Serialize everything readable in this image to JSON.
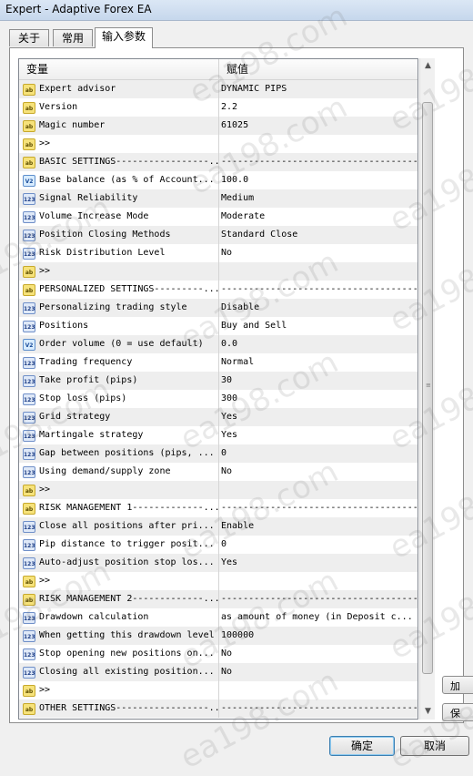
{
  "window": {
    "title": "Expert - Adaptive Forex EA"
  },
  "tabs": [
    {
      "label": "关于"
    },
    {
      "label": "常用"
    },
    {
      "label": "输入参数"
    }
  ],
  "grid": {
    "header": {
      "variable": "变量",
      "value": "赋值"
    },
    "rows": [
      {
        "icon": "ab",
        "name": "Expert advisor",
        "value": "DYNAMIC PIPS"
      },
      {
        "icon": "ab",
        "name": "Version",
        "value": "2.2"
      },
      {
        "icon": "ab",
        "name": "Magic number",
        "value": "61025"
      },
      {
        "icon": "ab",
        "name": ">>",
        "value": ""
      },
      {
        "icon": "ab",
        "name": "BASIC SETTINGS-----------------...",
        "value": "------------------------------------..."
      },
      {
        "icon": "v2",
        "name": "Base balance (as % of Account...",
        "value": "100.0"
      },
      {
        "icon": "123",
        "name": "Signal Reliability",
        "value": "Medium"
      },
      {
        "icon": "123",
        "name": "Volume Increase Mode",
        "value": "Moderate"
      },
      {
        "icon": "123",
        "name": "Position Closing Methods",
        "value": "Standard Close"
      },
      {
        "icon": "123",
        "name": "Risk Distribution Level",
        "value": "No"
      },
      {
        "icon": "ab",
        "name": ">>",
        "value": ""
      },
      {
        "icon": "ab",
        "name": "PERSONALIZED SETTINGS---------...",
        "value": "------------------------------------..."
      },
      {
        "icon": "123",
        "name": "Personalizing trading style",
        "value": "Disable"
      },
      {
        "icon": "123",
        "name": "Positions",
        "value": "Buy and Sell"
      },
      {
        "icon": "v2",
        "name": "Order volume (0 = use default)",
        "value": "0.0"
      },
      {
        "icon": "123",
        "name": "Trading frequency",
        "value": "Normal"
      },
      {
        "icon": "123",
        "name": "Take profit (pips)",
        "value": "30"
      },
      {
        "icon": "123",
        "name": "Stop loss (pips)",
        "value": "300"
      },
      {
        "icon": "123",
        "name": "Grid strategy",
        "value": "Yes"
      },
      {
        "icon": "123",
        "name": "Martingale strategy",
        "value": "Yes"
      },
      {
        "icon": "123",
        "name": "Gap between positions (pips, ...",
        "value": "0"
      },
      {
        "icon": "123",
        "name": "Using demand/supply zone",
        "value": "No"
      },
      {
        "icon": "ab",
        "name": ">>",
        "value": ""
      },
      {
        "icon": "ab",
        "name": "RISK MANAGEMENT 1-------------...",
        "value": "------------------------------------..."
      },
      {
        "icon": "123",
        "name": "Close all positions after pri...",
        "value": "Enable"
      },
      {
        "icon": "123",
        "name": "Pip distance to trigger posit...",
        "value": "0"
      },
      {
        "icon": "123",
        "name": "Auto-adjust position stop los...",
        "value": "Yes"
      },
      {
        "icon": "ab",
        "name": ">>",
        "value": ""
      },
      {
        "icon": "ab",
        "name": "RISK MANAGEMENT 2-------------...",
        "value": "------------------------------------..."
      },
      {
        "icon": "123",
        "name": "Drawdown calculation",
        "value": "as amount of money (in Deposit c..."
      },
      {
        "icon": "123",
        "name": "When getting this drawdown level",
        "value": "100000"
      },
      {
        "icon": "123",
        "name": "Stop opening new positions on...",
        "value": "No"
      },
      {
        "icon": "123",
        "name": "Closing all existing position...",
        "value": "No"
      },
      {
        "icon": "ab",
        "name": ">>",
        "value": ""
      },
      {
        "icon": "ab",
        "name": "OTHER SETTINGS-----------------...",
        "value": "------------------------------------..."
      }
    ]
  },
  "buttons": {
    "ok": "确定",
    "cancel": "取消"
  },
  "side_buttons": {
    "load": "加",
    "save": "保"
  },
  "watermark": "ea198.com"
}
